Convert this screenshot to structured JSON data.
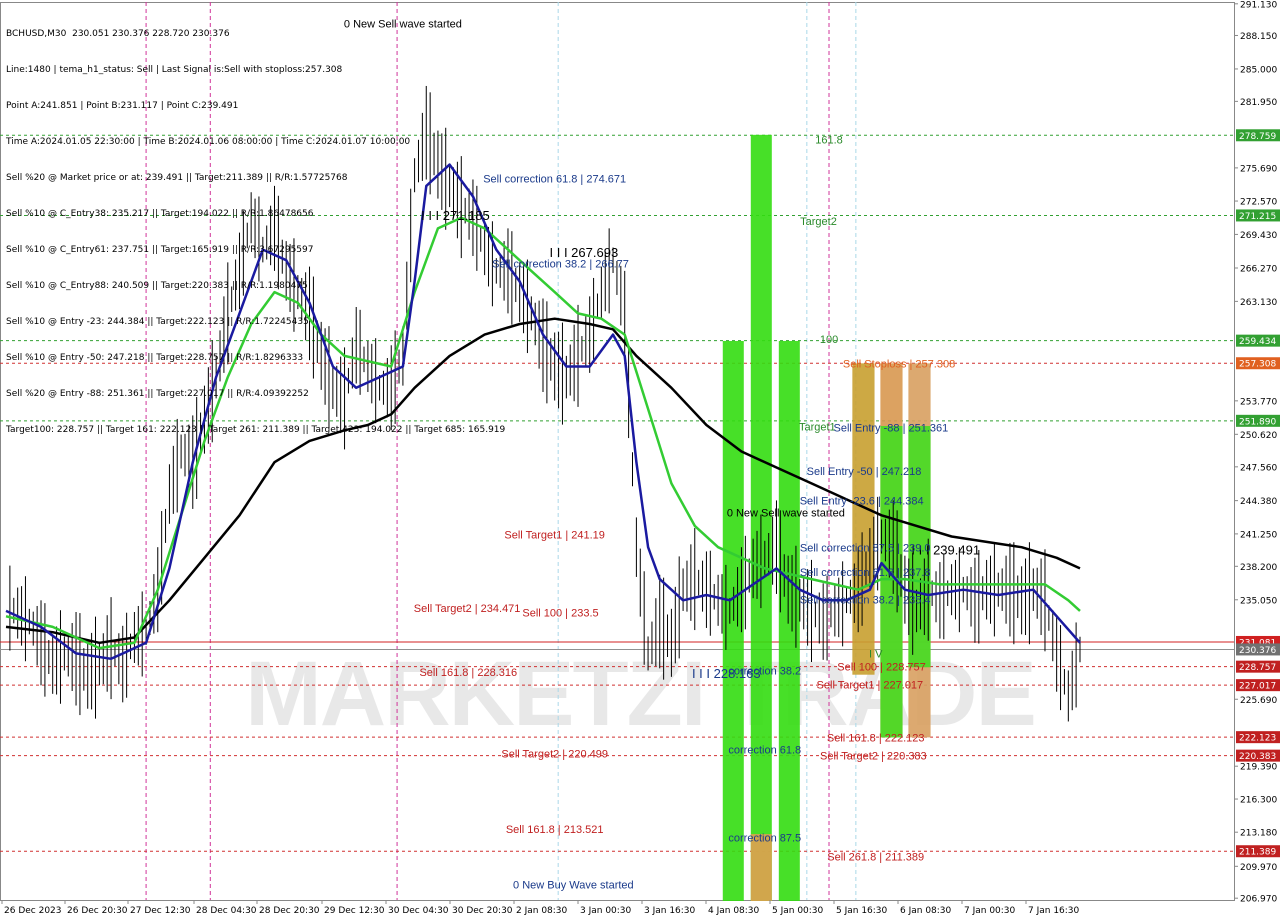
{
  "header": {
    "symbol_line": "BCHUSD,M30  230.051 230.376 228.720 230.376",
    "lines": [
      "Line:1480 | tema_h1_status: Sell | Last Signal is:Sell with stoploss:257.308",
      "Point A:241.851 | Point B:231.117 | Point C:239.491",
      "Time A:2024.01.05 22:30:00 | Time B:2024.01.06 08:00:00 | Time C:2024.01.07 10:00:00",
      "Sell %20 @ Market price or at: 239.491 || Target:211.389 || R/R:1.57725768",
      "Sell %10 @ C_Entry38: 235.217 || Target:194.022 || R/R:1.86478656",
      "Sell %10 @ C_Entry61: 237.751 || Target:165.919 || R/R:3.67295597",
      "Sell %10 @ C_Entry88: 240.509 || Target:220.383 || R/R:1.1980475",
      "Sell %10 @ Entry -23: 244.384 || Target:222.123 || R/R:1.72245435",
      "Sell %10 @ Entry -50: 247.218 || Target:228.757 || R/R:1.8296333",
      "Sell %20 @ Entry -88: 251.361 || Target:227.017 || R/R:4.09392252",
      "Target100: 228.757 || Target 161: 222.123 || Target 261: 211.389 || Target 423: 194.022 || Target 685: 165.919"
    ]
  },
  "chart_data": {
    "type": "line",
    "title": "BCHUSD,M30",
    "ylim": [
      206.8,
      291.3
    ],
    "price_ticks": [
      "291.130",
      "288.150",
      "285.000",
      "281.950",
      "278.759",
      "275.690",
      "272.570",
      "271.215",
      "269.430",
      "266.270",
      "263.130",
      "259.434",
      "257.308",
      "253.770",
      "251.890",
      "250.620",
      "247.560",
      "244.380",
      "241.250",
      "238.200",
      "235.050",
      "231.081",
      "230.376",
      "228.757",
      "227.017",
      "225.690",
      "222.123",
      "220.383",
      "219.390",
      "216.300",
      "213.180",
      "211.389",
      "209.970",
      "206.970"
    ],
    "time_labels": [
      "26 Dec 2023",
      "26 Dec 20:30",
      "27 Dec 12:30",
      "28 Dec 04:30",
      "28 Dec 20:30",
      "29 Dec 12:30",
      "30 Dec 04:30",
      "30 Dec 20:30",
      "2 Jan 08:30",
      "3 Jan 00:30",
      "3 Jan 16:30",
      "4 Jan 08:30",
      "5 Jan 00:30",
      "5 Jan 16:30",
      "6 Jan 08:30",
      "7 Jan 00:30",
      "7 Jan 16:30"
    ],
    "close_series": [
      [
        0,
        234.5
      ],
      [
        1,
        233.8
      ],
      [
        2,
        233.0
      ],
      [
        3,
        231.0
      ],
      [
        4,
        229.0
      ],
      [
        5,
        230.0
      ],
      [
        6,
        229.5
      ],
      [
        7,
        228.0
      ],
      [
        8,
        229.0
      ],
      [
        9,
        230.5
      ],
      [
        10,
        229.0
      ],
      [
        11,
        231.5
      ],
      [
        12,
        232.0
      ],
      [
        13,
        236.0
      ],
      [
        14,
        245.0
      ],
      [
        15,
        249.0
      ],
      [
        16,
        248.0
      ],
      [
        17,
        252.0
      ],
      [
        18,
        256.0
      ],
      [
        19,
        262.0
      ],
      [
        20,
        266.0
      ],
      [
        21,
        271.0
      ],
      [
        22,
        268.0
      ],
      [
        23,
        270.0
      ],
      [
        24,
        266.0
      ],
      [
        25,
        264.0
      ],
      [
        26,
        262.0
      ],
      [
        27,
        258.0
      ],
      [
        28,
        255.0
      ],
      [
        29,
        254.0
      ],
      [
        30,
        259.0
      ],
      [
        31,
        257.0
      ],
      [
        32,
        255.0
      ],
      [
        33,
        255.0
      ],
      [
        34,
        258.0
      ],
      [
        35,
        275.0
      ],
      [
        36,
        279.0
      ],
      [
        37,
        276.0
      ],
      [
        38,
        274.0
      ],
      [
        39,
        272.0
      ],
      [
        40,
        271.0
      ],
      [
        41,
        268.0
      ],
      [
        42,
        266.0
      ],
      [
        43,
        266.0
      ],
      [
        44,
        264.0
      ],
      [
        45,
        262.0
      ],
      [
        46,
        259.0
      ],
      [
        47,
        257.0
      ],
      [
        48,
        256.0
      ],
      [
        49,
        258.0
      ],
      [
        50,
        260.0
      ],
      [
        51,
        264.0
      ],
      [
        52,
        267.0
      ],
      [
        53,
        262.0
      ],
      [
        54,
        240.0
      ],
      [
        55,
        230.0
      ],
      [
        56,
        233.0
      ],
      [
        57,
        231.0
      ],
      [
        58,
        236.0
      ],
      [
        59,
        237.0
      ],
      [
        60,
        236.0
      ],
      [
        61,
        235.0
      ],
      [
        62,
        234.0
      ],
      [
        63,
        236.0
      ],
      [
        64,
        238.0
      ],
      [
        65,
        239.0
      ],
      [
        66,
        240.0
      ],
      [
        67,
        236.0
      ],
      [
        68,
        235.0
      ],
      [
        69,
        234.0
      ],
      [
        70,
        233.0
      ],
      [
        71,
        234.0
      ],
      [
        72,
        235.0
      ],
      [
        73,
        236.0
      ],
      [
        74,
        239.0
      ],
      [
        75,
        241.0
      ],
      [
        76,
        240.0
      ],
      [
        77,
        236.0
      ],
      [
        78,
        234.0
      ],
      [
        79,
        236.0
      ],
      [
        80,
        235.0
      ],
      [
        81,
        236.0
      ],
      [
        82,
        236.0
      ],
      [
        83,
        235.0
      ],
      [
        84,
        236.0
      ],
      [
        85,
        236.0
      ],
      [
        86,
        236.0
      ],
      [
        87,
        235.0
      ],
      [
        88,
        236.0
      ],
      [
        89,
        235.0
      ],
      [
        90,
        230.0
      ],
      [
        91,
        226.0
      ],
      [
        92,
        230.376
      ]
    ],
    "tema_series": [
      [
        0,
        234.0
      ],
      [
        3,
        232.5
      ],
      [
        6,
        230.0
      ],
      [
        9,
        229.5
      ],
      [
        12,
        231.0
      ],
      [
        14,
        238.0
      ],
      [
        16,
        248.0
      ],
      [
        18,
        256.0
      ],
      [
        20,
        262.0
      ],
      [
        22,
        268.0
      ],
      [
        24,
        267.0
      ],
      [
        26,
        263.0
      ],
      [
        28,
        257.0
      ],
      [
        30,
        255.0
      ],
      [
        32,
        256.0
      ],
      [
        34,
        257.0
      ],
      [
        35,
        265.0
      ],
      [
        36,
        274.0
      ],
      [
        38,
        276.0
      ],
      [
        40,
        273.0
      ],
      [
        42,
        268.0
      ],
      [
        44,
        265.0
      ],
      [
        46,
        260.0
      ],
      [
        48,
        257.0
      ],
      [
        50,
        257.0
      ],
      [
        52,
        260.0
      ],
      [
        53,
        258.0
      ],
      [
        54,
        248.0
      ],
      [
        55,
        240.0
      ],
      [
        56,
        237.0
      ],
      [
        58,
        235.0
      ],
      [
        60,
        235.5
      ],
      [
        62,
        235.0
      ],
      [
        64,
        236.5
      ],
      [
        66,
        238.0
      ],
      [
        68,
        236.0
      ],
      [
        70,
        235.0
      ],
      [
        72,
        235.0
      ],
      [
        74,
        236.0
      ],
      [
        75,
        238.5
      ],
      [
        77,
        236.0
      ],
      [
        79,
        235.5
      ],
      [
        82,
        236.0
      ],
      [
        85,
        235.5
      ],
      [
        88,
        236.0
      ],
      [
        90,
        233.5
      ],
      [
        92,
        231.0
      ]
    ],
    "ema_green_series": [
      [
        0,
        233.5
      ],
      [
        4,
        232.5
      ],
      [
        8,
        230.5
      ],
      [
        11,
        231.0
      ],
      [
        13,
        236.0
      ],
      [
        15,
        243.0
      ],
      [
        17,
        250.0
      ],
      [
        19,
        256.0
      ],
      [
        21,
        261.0
      ],
      [
        23,
        264.0
      ],
      [
        25,
        263.0
      ],
      [
        27,
        260.0
      ],
      [
        29,
        258.0
      ],
      [
        31,
        257.5
      ],
      [
        33,
        257.0
      ],
      [
        35,
        264.0
      ],
      [
        37,
        270.0
      ],
      [
        39,
        271.0
      ],
      [
        41,
        270.0
      ],
      [
        43,
        268.0
      ],
      [
        45,
        266.0
      ],
      [
        47,
        264.0
      ],
      [
        49,
        262.0
      ],
      [
        51,
        261.5
      ],
      [
        53,
        260.0
      ],
      [
        55,
        253.0
      ],
      [
        57,
        246.0
      ],
      [
        59,
        242.0
      ],
      [
        61,
        240.0
      ],
      [
        63,
        239.0
      ],
      [
        65,
        238.0
      ],
      [
        67,
        237.5
      ],
      [
        69,
        237.0
      ],
      [
        71,
        236.5
      ],
      [
        73,
        236.0
      ],
      [
        75,
        237.0
      ],
      [
        77,
        237.0
      ],
      [
        80,
        236.5
      ],
      [
        83,
        236.5
      ],
      [
        86,
        236.5
      ],
      [
        89,
        236.5
      ],
      [
        91,
        235.0
      ],
      [
        92,
        234.0
      ]
    ],
    "ma_black_series": [
      [
        0,
        232.5
      ],
      [
        4,
        232.0
      ],
      [
        8,
        231.0
      ],
      [
        11,
        231.5
      ],
      [
        14,
        235.0
      ],
      [
        17,
        239.0
      ],
      [
        20,
        243.0
      ],
      [
        23,
        248.0
      ],
      [
        26,
        250.0
      ],
      [
        29,
        251.0
      ],
      [
        31,
        251.5
      ],
      [
        33,
        252.5
      ],
      [
        35,
        255.0
      ],
      [
        38,
        258.0
      ],
      [
        41,
        260.0
      ],
      [
        44,
        261.0
      ],
      [
        47,
        261.5
      ],
      [
        50,
        261.0
      ],
      [
        52,
        260.5
      ],
      [
        54,
        258.0
      ],
      [
        57,
        255.0
      ],
      [
        60,
        251.5
      ],
      [
        63,
        249.0
      ],
      [
        66,
        247.5
      ],
      [
        69,
        246.0
      ],
      [
        72,
        244.5
      ],
      [
        75,
        243.0
      ],
      [
        78,
        242.0
      ],
      [
        81,
        241.0
      ],
      [
        84,
        240.5
      ],
      [
        87,
        240.0
      ],
      [
        90,
        239.0
      ],
      [
        92,
        238.0
      ]
    ],
    "h_levels": [
      {
        "price": 278.759,
        "style": "green-dash",
        "label": "278.759",
        "tag_color": "#32a032"
      },
      {
        "price": 271.215,
        "style": "green-dash",
        "label": "271.215",
        "tag_color": "#32a032"
      },
      {
        "price": 259.434,
        "style": "green-dash",
        "label": "259.434",
        "tag_color": "#32a032"
      },
      {
        "price": 257.308,
        "style": "red-dash",
        "label": "257.308",
        "tag_color": "#e06020"
      },
      {
        "price": 251.89,
        "style": "green-dash",
        "label": "251.890",
        "tag_color": "#32a032"
      },
      {
        "price": 231.081,
        "style": "red-solid",
        "label": "231.081",
        "tag_color": "#d02020"
      },
      {
        "price": 230.376,
        "style": "gray-solid",
        "label": "230.376",
        "tag_color": "#707070"
      },
      {
        "price": 228.757,
        "style": "red-dash",
        "label": "228.757",
        "tag_color": "#c02020"
      },
      {
        "price": 227.017,
        "style": "red-dash",
        "label": "227.017",
        "tag_color": "#c02020"
      },
      {
        "price": 222.123,
        "style": "red-dash",
        "label": "222.123",
        "tag_color": "#c02020"
      },
      {
        "price": 220.383,
        "style": "red-dash",
        "label": "220.383",
        "tag_color": "#c02020"
      },
      {
        "price": 211.389,
        "style": "red-dash",
        "label": "211.389",
        "tag_color": "#c02020"
      }
    ],
    "annotations": [
      {
        "t": "0 New Sell wave started",
        "bar": 34.0,
        "price": 288.9,
        "color": "#000000"
      },
      {
        "t": "Sell correction 61.8 | 274.671",
        "bar": 47.0,
        "price": 274.3,
        "color": "#1a3a8a"
      },
      {
        "t": "I I I 271.185",
        "bar": 38.5,
        "price": 270.8,
        "color": "#000000",
        "size": 13
      },
      {
        "t": "I I I 267.693",
        "bar": 49.5,
        "price": 267.3,
        "color": "#000000",
        "size": 13
      },
      {
        "t": "Sell correction 38.2 | 266.77",
        "bar": 47.5,
        "price": 266.3,
        "color": "#1a3a8a"
      },
      {
        "t": "161.8",
        "bar": 70.5,
        "price": 278.0,
        "color": "#2a8a2a"
      },
      {
        "t": "Target2",
        "bar": 69.6,
        "price": 270.3,
        "color": "#2a8a2a"
      },
      {
        "t": "100",
        "bar": 70.5,
        "price": 259.2,
        "color": "#2a8a2a"
      },
      {
        "t": "Target1",
        "bar": 69.5,
        "price": 251.0,
        "color": "#2a8a2a"
      },
      {
        "t": "Sell Stoploss | 257.308",
        "bar": 76.5,
        "price": 256.9,
        "color": "#e06020"
      },
      {
        "t": "Sell Entry -88 | 251.361",
        "bar": 75.8,
        "price": 250.9,
        "color": "#1a3a8a"
      },
      {
        "t": "Sell Entry -50 | 247.218",
        "bar": 73.5,
        "price": 246.8,
        "color": "#1a3a8a"
      },
      {
        "t": "Sell Entry -23.6 | 244.384",
        "bar": 73.3,
        "price": 244.0,
        "color": "#1a3a8a"
      },
      {
        "t": "0 New Sell wave started",
        "bar": 66.8,
        "price": 242.9,
        "color": "#000000"
      },
      {
        "t": "Sell Target1 | 241.19",
        "bar": 47.0,
        "price": 240.8,
        "color": "#c02020"
      },
      {
        "t": "I I I 239.491",
        "bar": 80.5,
        "price": 239.3,
        "color": "#000000",
        "size": 13
      },
      {
        "t": "Sell correction 87.5 | 239.0",
        "bar": 73.6,
        "price": 239.6,
        "color": "#1a3a8a"
      },
      {
        "t": "Sell correction 61.8 | 237.8",
        "bar": 73.6,
        "price": 237.3,
        "color": "#1a3a8a"
      },
      {
        "t": "Sell correction 38.2 | 235.4",
        "bar": 73.6,
        "price": 234.7,
        "color": "#1a3a8a"
      },
      {
        "t": "Sell Target2 | 234.471",
        "bar": 39.5,
        "price": 233.9,
        "color": "#c02020"
      },
      {
        "t": "Sell 100 | 233.5",
        "bar": 47.5,
        "price": 233.5,
        "color": "#c02020"
      },
      {
        "t": "I V",
        "bar": 74.5,
        "price": 229.6,
        "color": "#2a8a2a"
      },
      {
        "t": "Sell 100 | 228.757",
        "bar": 75.0,
        "price": 228.4,
        "color": "#c02020"
      },
      {
        "t": "Sell 161.8 | 228.316",
        "bar": 39.6,
        "price": 227.9,
        "color": "#c02020"
      },
      {
        "t": "I I I 228.163",
        "bar": 61.7,
        "price": 227.7,
        "color": "#1a3a8a",
        "size": 13
      },
      {
        "t": "correction 38.2",
        "bar": 65.0,
        "price": 228.0,
        "color": "#1a3a8a"
      },
      {
        "t": "Sell Target1 | 227.017",
        "bar": 74.0,
        "price": 226.7,
        "color": "#c02020"
      },
      {
        "t": "Sell 161.8 | 222.123",
        "bar": 74.5,
        "price": 221.7,
        "color": "#c02020"
      },
      {
        "t": "Sell Target2 | 220.499",
        "bar": 47.0,
        "price": 220.2,
        "color": "#c02020"
      },
      {
        "t": "correction 61.8",
        "bar": 65.0,
        "price": 220.6,
        "color": "#1a3a8a"
      },
      {
        "t": "Sell Target2 | 220.383",
        "bar": 74.3,
        "price": 220.0,
        "color": "#c02020"
      },
      {
        "t": "Sell 161.8 | 213.521",
        "bar": 47.0,
        "price": 213.1,
        "color": "#c02020"
      },
      {
        "t": "correction 87.5",
        "bar": 65.0,
        "price": 212.3,
        "color": "#1a3a8a"
      },
      {
        "t": "Sell  261.8 | 211.389",
        "bar": 74.5,
        "price": 210.5,
        "color": "#c02020"
      },
      {
        "t": "0 New Buy Wave started",
        "bar": 48.6,
        "price": 207.9,
        "color": "#1a3a8a"
      }
    ],
    "bands": [
      {
        "b0": 61.4,
        "b1": 63.2,
        "p0": 206.5,
        "p1": 259.4,
        "color": "#33dd11"
      },
      {
        "b0": 63.8,
        "b1": 65.6,
        "p0": 206.5,
        "p1": 278.8,
        "color": "#33dd11"
      },
      {
        "b0": 66.2,
        "b1": 68.0,
        "p0": 206.5,
        "p1": 259.4,
        "color": "#33dd11"
      },
      {
        "b0": 63.8,
        "b1": 65.6,
        "p0": 206.5,
        "p1": 213.0,
        "color": "#e0a050"
      },
      {
        "b0": 72.5,
        "b1": 74.4,
        "p0": 228.0,
        "p1": 257.3,
        "color": "#c8a030"
      },
      {
        "b0": 74.9,
        "b1": 76.8,
        "p0": 222.1,
        "p1": 257.3,
        "color": "#d89850"
      },
      {
        "b0": 77.3,
        "b1": 79.2,
        "p0": 222.1,
        "p1": 257.3,
        "color": "#d8a060"
      },
      {
        "b0": 74.9,
        "b1": 76.8,
        "p0": 222.1,
        "p1": 251.4,
        "color": "#44dd22"
      },
      {
        "b0": 77.3,
        "b1": 79.2,
        "p0": 228.7,
        "p1": 251.4,
        "color": "#44dd22"
      }
    ],
    "v_lines": [
      12.0,
      17.5,
      33.5,
      70.5
    ],
    "watermark": "MARKETZI TRADE",
    "wm_tail": "TRADE"
  }
}
